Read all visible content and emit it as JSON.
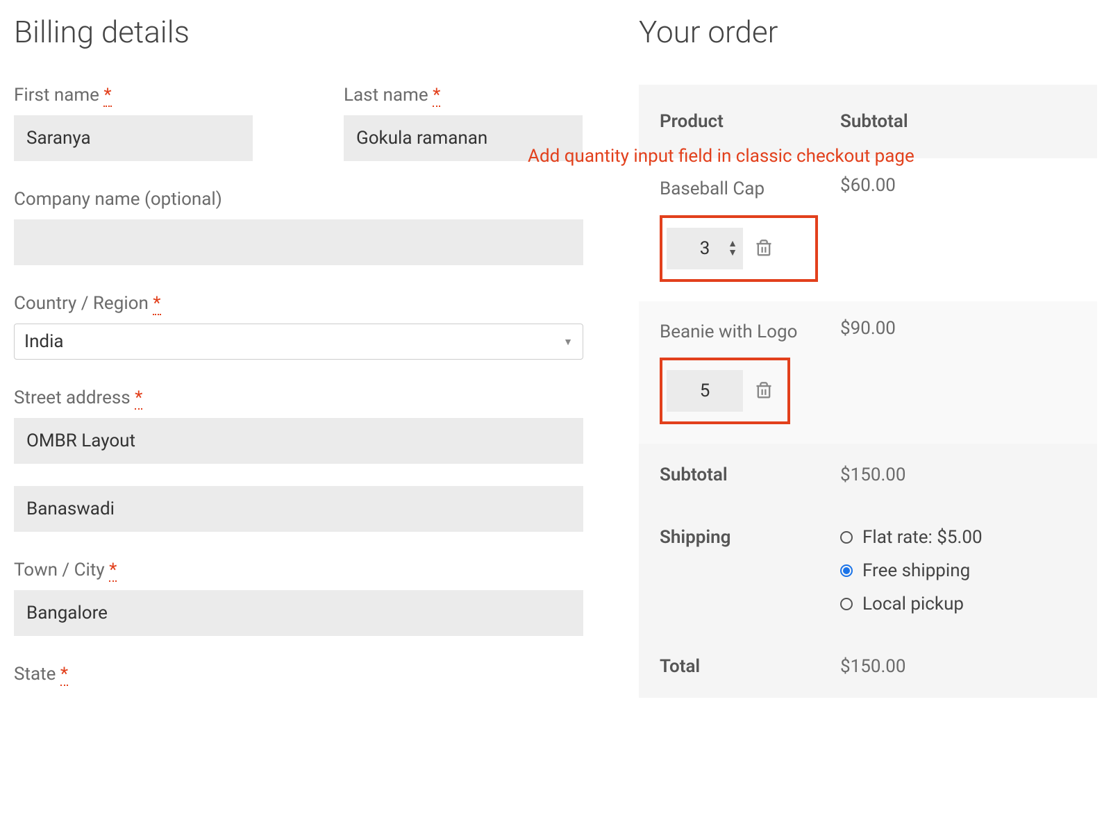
{
  "billing": {
    "heading": "Billing details",
    "first_name_label": "First name",
    "first_name_value": "Saranya",
    "last_name_label": "Last name",
    "last_name_value": "Gokula ramanan",
    "company_label": "Company name (optional)",
    "company_value": "",
    "country_label": "Country / Region",
    "country_value": "India",
    "street_label": "Street address",
    "street1_value": "OMBR Layout",
    "street2_value": "Banaswadi",
    "city_label": "Town / City",
    "city_value": "Bangalore",
    "state_label": "State",
    "required_glyph": "*"
  },
  "order": {
    "heading": "Your order",
    "annotation": "Add quantity input field in classic checkout page",
    "col_product": "Product",
    "col_subtotal": "Subtotal",
    "items": [
      {
        "name": "Baseball Cap",
        "qty": "3",
        "subtotal": "$60.00"
      },
      {
        "name": "Beanie with Logo",
        "qty": "5",
        "subtotal": "$90.00"
      }
    ],
    "subtotal_label": "Subtotal",
    "subtotal_value": "$150.00",
    "shipping_label": "Shipping",
    "shipping_options": [
      {
        "label": "Flat rate: $5.00",
        "checked": false
      },
      {
        "label": "Free shipping",
        "checked": true
      },
      {
        "label": "Local pickup",
        "checked": false
      }
    ],
    "total_label": "Total",
    "total_value": "$150.00"
  }
}
